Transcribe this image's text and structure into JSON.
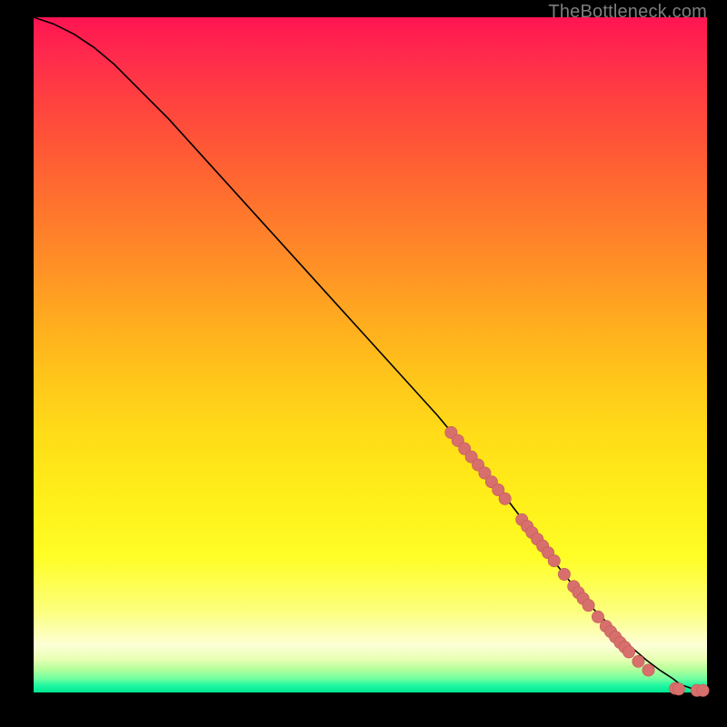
{
  "watermark": "TheBottleneck.com",
  "chart_data": {
    "type": "line",
    "title": "",
    "xlabel": "",
    "ylabel": "",
    "xlim": [
      0,
      100
    ],
    "ylim": [
      0,
      100
    ],
    "grid": false,
    "series": [
      {
        "name": "curve",
        "x": [
          0,
          3,
          6,
          9,
          12,
          15,
          20,
          25,
          30,
          35,
          40,
          45,
          50,
          55,
          60,
          65,
          70,
          75,
          78,
          80,
          83,
          85,
          87,
          89,
          91,
          93,
          95,
          96,
          98,
          100
        ],
        "y": [
          100,
          99,
          97.5,
          95.5,
          93,
          90,
          85,
          79.5,
          74,
          68.5,
          63,
          57.5,
          52,
          46.5,
          41,
          35,
          29,
          22.5,
          18.5,
          16,
          12.5,
          10.5,
          8.5,
          6.5,
          4.8,
          3.3,
          2.0,
          1.2,
          0.5,
          0.3
        ]
      }
    ],
    "markers": [
      {
        "x": 62.0,
        "y": 38.5
      },
      {
        "x": 63.0,
        "y": 37.3
      },
      {
        "x": 64.0,
        "y": 36.1
      },
      {
        "x": 65.0,
        "y": 34.9
      },
      {
        "x": 66.0,
        "y": 33.7
      },
      {
        "x": 67.0,
        "y": 32.5
      },
      {
        "x": 68.0,
        "y": 31.2
      },
      {
        "x": 69.0,
        "y": 30.0
      },
      {
        "x": 70.0,
        "y": 28.7
      },
      {
        "x": 72.5,
        "y": 25.6
      },
      {
        "x": 73.3,
        "y": 24.6
      },
      {
        "x": 74.0,
        "y": 23.7
      },
      {
        "x": 74.8,
        "y": 22.7
      },
      {
        "x": 75.6,
        "y": 21.7
      },
      {
        "x": 76.4,
        "y": 20.7
      },
      {
        "x": 77.3,
        "y": 19.5
      },
      {
        "x": 78.8,
        "y": 17.5
      },
      {
        "x": 80.2,
        "y": 15.7
      },
      {
        "x": 80.9,
        "y": 14.8
      },
      {
        "x": 81.6,
        "y": 13.9
      },
      {
        "x": 82.4,
        "y": 12.9
      },
      {
        "x": 83.8,
        "y": 11.2
      },
      {
        "x": 85.0,
        "y": 9.8
      },
      {
        "x": 85.7,
        "y": 9.0
      },
      {
        "x": 86.4,
        "y": 8.2
      },
      {
        "x": 87.1,
        "y": 7.4
      },
      {
        "x": 87.8,
        "y": 6.7
      },
      {
        "x": 88.4,
        "y": 6.0
      },
      {
        "x": 89.8,
        "y": 4.6
      },
      {
        "x": 91.3,
        "y": 3.3
      },
      {
        "x": 95.3,
        "y": 0.6
      },
      {
        "x": 95.8,
        "y": 0.5
      },
      {
        "x": 98.5,
        "y": 0.3
      },
      {
        "x": 99.4,
        "y": 0.3
      }
    ],
    "marker_radius_data_units": 0.9,
    "colors": {
      "curve": "#000000",
      "marker_fill": "#d76f6c",
      "marker_stroke": "#c25a57"
    }
  }
}
